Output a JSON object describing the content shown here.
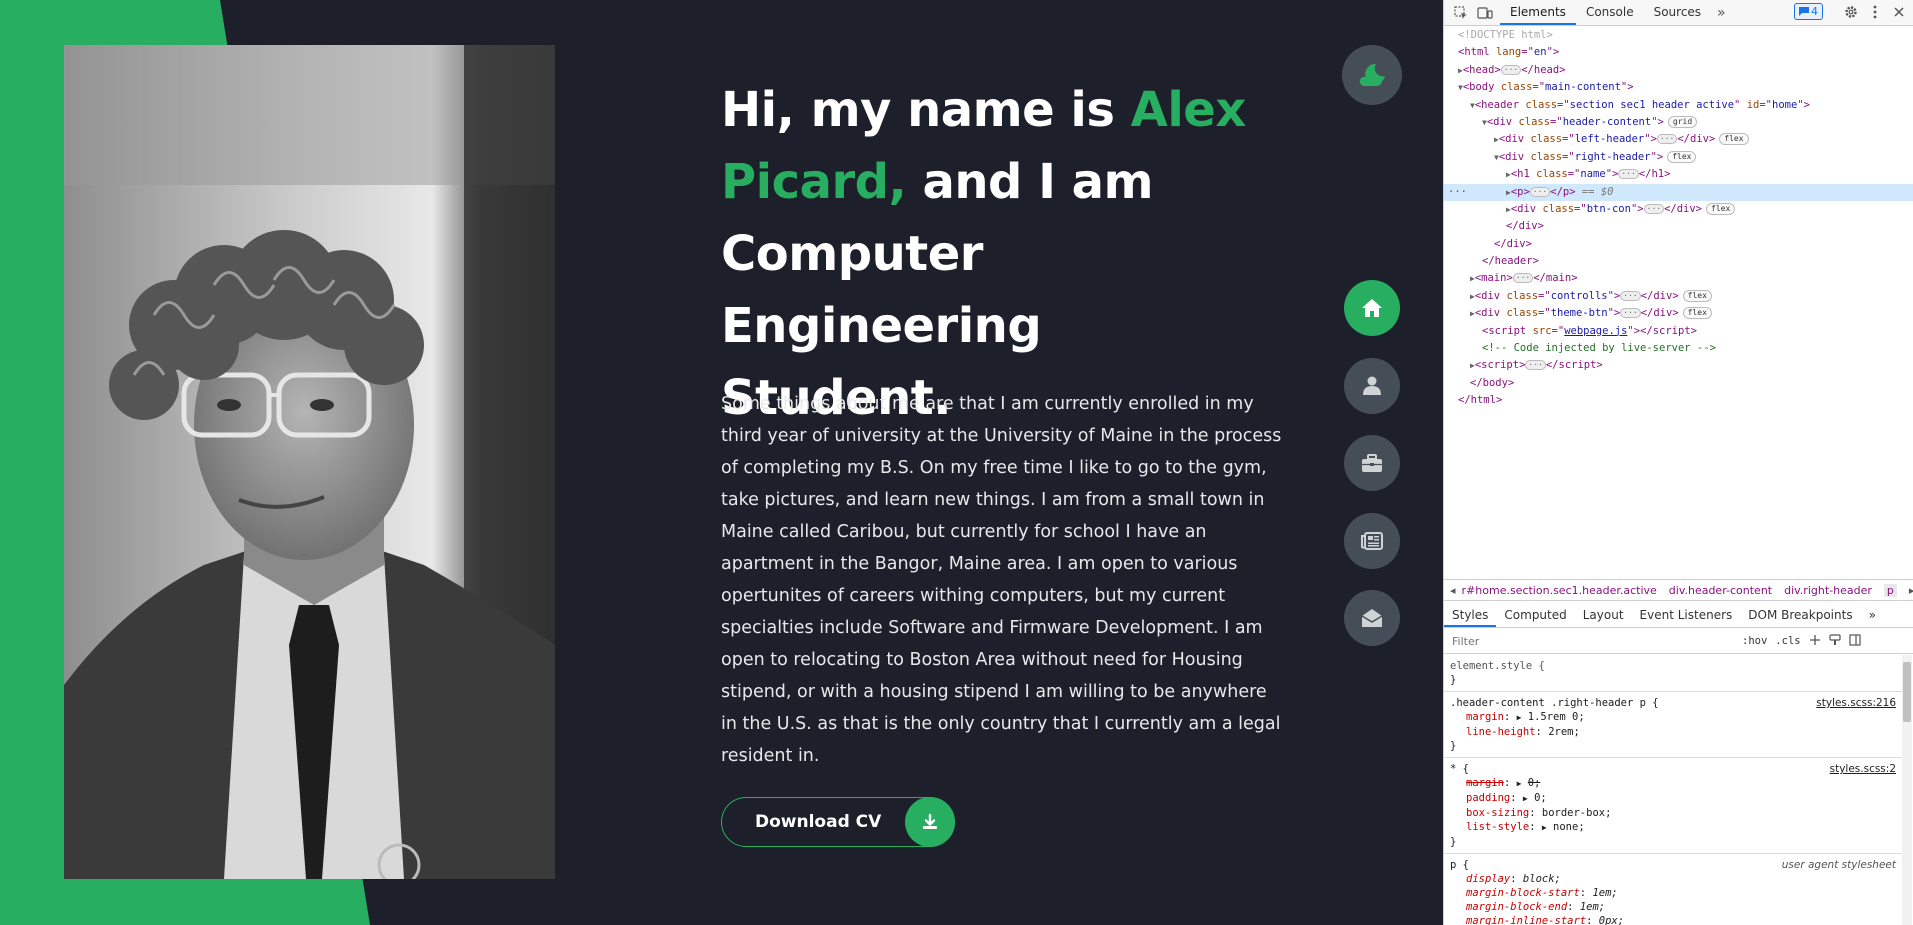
{
  "hero": {
    "greeting": "Hi, my name is ",
    "name": "Alex Picard,",
    "title_rest": " and I am Computer Engineering Student.",
    "about": "Some things about me are that I am currently enrolled in my third year of university at the University of Maine in the process of completing my B.S. On my free time I like to go to the gym, take pictures, and learn new things. I am from a small town in Maine called Caribou, but currently for school I have an apartment in the Bangor, Maine area. I am open to various opertunites of careers withing computers, but my current specialties include Software and Firmware Development. I am open to relocating to Boston Area without need for Housing stipend, or with a housing stipend I am willing to be anywhere in the U.S. as that is the only country that I currently am a legal resident in.",
    "cv_button": "Download CV",
    "cv_icon": "download-icon",
    "photo_icon": "portrait-photo"
  },
  "theme_button": {
    "icon": "moon-cloud-icon"
  },
  "controls": [
    {
      "name": "home",
      "icon": "home-icon",
      "active": true
    },
    {
      "name": "about",
      "icon": "user-icon",
      "active": false
    },
    {
      "name": "portfolio",
      "icon": "briefcase-icon",
      "active": false
    },
    {
      "name": "blogs",
      "icon": "newspaper-icon",
      "active": false
    },
    {
      "name": "contact",
      "icon": "envelope-open-icon",
      "active": false
    }
  ],
  "colors": {
    "accent": "#27ae60",
    "background": "#1d202b",
    "control": "#454e56"
  },
  "devtools": {
    "tabs": [
      "Elements",
      "Console",
      "Sources"
    ],
    "more": "»",
    "issues_count": "4",
    "dom": {
      "doctype": "<!DOCTYPE html>",
      "html_open_tag": "html",
      "html_lang_attr": "lang",
      "html_lang_val": "en",
      "head_tag": "head",
      "body_tag": "body",
      "body_class_val": "main-content",
      "header_class_val": "section sec1 header active",
      "header_id_val": "home",
      "header_content_class": "header-content",
      "grid_pill": "grid",
      "left_header_class": "left-header",
      "flex_pill": "flex",
      "right_header_class": "right-header",
      "h1_class": "name",
      "p_eq": "== $0",
      "btn_con_class": "btn-con",
      "main_tag": "main",
      "controlls_class": "controlls",
      "theme_btn_class": "theme-btn",
      "script_src": "webpage.js",
      "comment": "<!-- Code injected by live-server -->"
    },
    "breadcrumb": [
      "r#home.section.sec1.header.active",
      "div.header-content",
      "div.right-header",
      "p"
    ],
    "subtabs": [
      "Styles",
      "Computed",
      "Layout",
      "Event Listeners",
      "DOM Breakpoints"
    ],
    "filter_placeholder": "Filter",
    "hov": ":hov",
    "cls": ".cls",
    "styles": {
      "element_style": "element.style {",
      "close": "}",
      "rule1_selector": ".header-content .right-header p {",
      "rule1_source": "styles.scss:216",
      "rule1_margin_prop": "margin",
      "rule1_margin_val": "1.5rem 0;",
      "rule1_lh_prop": "line-height",
      "rule1_lh_val": "2rem;",
      "rule2_selector": "* {",
      "rule2_source": "styles.scss:2",
      "rule2_margin_prop": "margin",
      "rule2_margin_val": "0;",
      "rule2_padding_prop": "padding",
      "rule2_padding_val": "0;",
      "rule2_boxsizing_prop": "box-sizing",
      "rule2_boxsizing_val": "border-box;",
      "rule2_liststyle_prop": "list-style",
      "rule2_liststyle_val": "none;",
      "rule3_selector": "p {",
      "rule3_source": "user agent stylesheet",
      "ua_display_prop": "display",
      "ua_display_val": "block;",
      "ua_mbs_prop": "margin-block-start",
      "ua_mbs_val": "1em;",
      "ua_mbe_prop": "margin-block-end",
      "ua_mbe_val": "1em;",
      "ua_mis_prop": "margin-inline-start",
      "ua_mis_val": "0px;"
    }
  }
}
